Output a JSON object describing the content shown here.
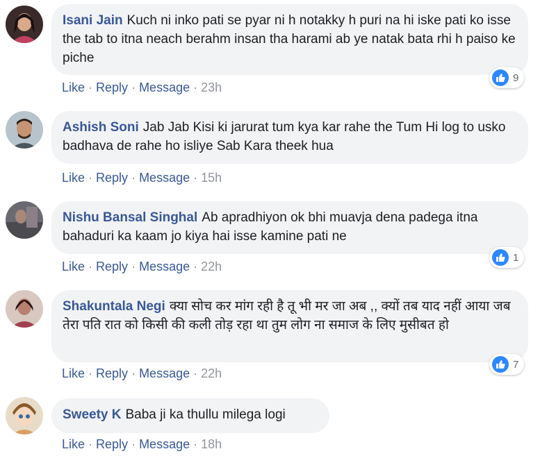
{
  "colors": {
    "link": "#385898",
    "bubble": "#f2f3f5",
    "meta": "#90949c",
    "like": "#2d88ff"
  },
  "actions": {
    "like": "Like",
    "reply": "Reply",
    "message": "Message",
    "dot": "·"
  },
  "comments": [
    {
      "author": "Isani Jain",
      "text": "Kuch ni inko pati se pyar ni h notakky h puri na hi iske pati ko isse the tab to itna neach berahm insan tha harami ab ye natak bata rhi h paiso ke piche",
      "time": "23h",
      "reactions": "9",
      "avatar": "avatar-woman-icon"
    },
    {
      "author": "Ashish Soni",
      "text": "Jab Jab Kisi ki jarurat tum kya kar rahe the Tum Hi log to usko badhava de rahe ho isliye Sab Kara theek hua",
      "time": "15h",
      "reactions": "",
      "avatar": "avatar-man-icon"
    },
    {
      "author": "Nishu Bansal Singhal",
      "text": "Ab apradhiyon ok bhi muavja dena padega itna bahaduri ka kaam jo kiya hai isse kamine pati ne",
      "time": "22h",
      "reactions": "1",
      "avatar": "avatar-photo-icon"
    },
    {
      "author": "Shakuntala Negi",
      "text": "क्या सोच कर मांग रही है तू भी मर जा अब ,, क्यों तब याद नहीं आया जब तेरा पति रात को किसी की कली तोड़ रहा था तुम लोग ना समाज के लिए मुसीबत हो",
      "time": "22h",
      "reactions": "7",
      "avatar": "avatar-woman-icon"
    },
    {
      "author": "Sweety K",
      "text": "Baba ji ka thullu milega logi",
      "time": "18h",
      "reactions": "",
      "avatar": "avatar-doll-icon"
    }
  ]
}
